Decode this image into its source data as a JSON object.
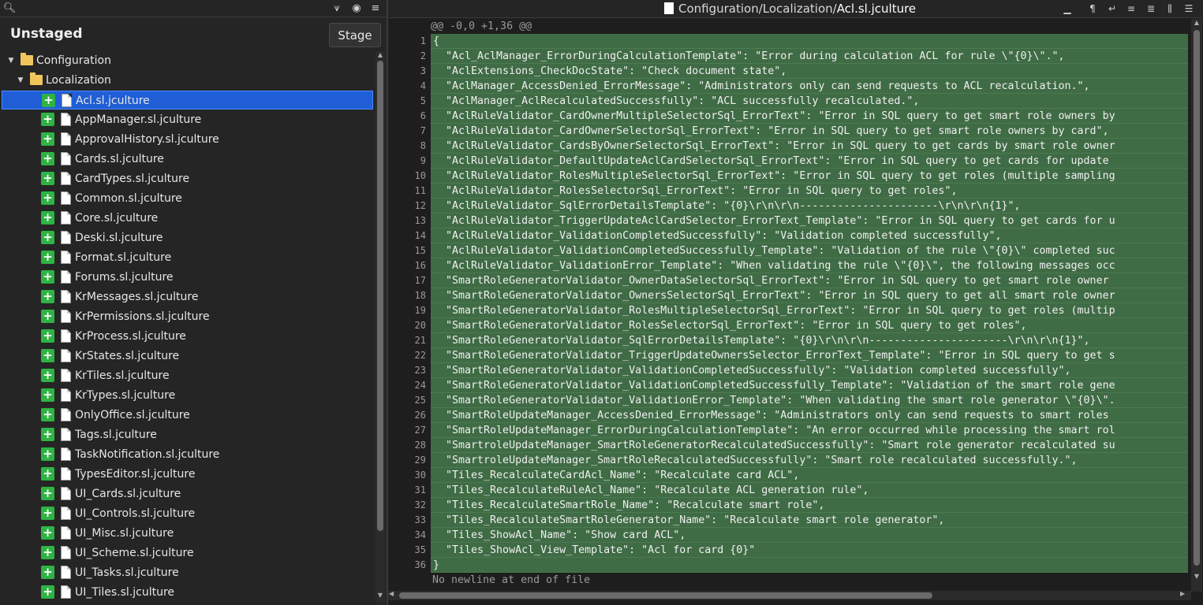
{
  "left_toolbar": {
    "search_placeholder": ""
  },
  "left_header": {
    "title": "Unstaged",
    "stage_label": "Stage"
  },
  "tree": {
    "folders": [
      {
        "label": "Configuration",
        "expanded": true
      },
      {
        "label": "Localization",
        "expanded": true
      }
    ],
    "selected_file": "Acl.sl.jculture",
    "files": [
      "Acl.sl.jculture",
      "AppManager.sl.jculture",
      "ApprovalHistory.sl.jculture",
      "Cards.sl.jculture",
      "CardTypes.sl.jculture",
      "Common.sl.jculture",
      "Core.sl.jculture",
      "Deski.sl.jculture",
      "Format.sl.jculture",
      "Forums.sl.jculture",
      "KrMessages.sl.jculture",
      "KrPermissions.sl.jculture",
      "KrProcess.sl.jculture",
      "KrStates.sl.jculture",
      "KrTiles.sl.jculture",
      "KrTypes.sl.jculture",
      "OnlyOffice.sl.jculture",
      "Tags.sl.jculture",
      "TaskNotification.sl.jculture",
      "TypesEditor.sl.jculture",
      "UI_Cards.sl.jculture",
      "UI_Controls.sl.jculture",
      "UI_Misc.sl.jculture",
      "UI_Scheme.sl.jculture",
      "UI_Tasks.sl.jculture",
      "UI_Tiles.sl.jculture"
    ]
  },
  "diff": {
    "path_prefix": "Configuration/Localization/",
    "file_name": "Acl.sl.jculture",
    "hunk_header": "@@ -0,0 +1,36 @@",
    "no_newline": "No newline at end of file",
    "lines": [
      "{",
      "  \"Acl_AclManager_ErrorDuringCalculationTemplate\": \"Error during calculation ACL for rule \\\"{0}\\\".\",",
      "  \"AclExtensions_CheckDocState\": \"Check document state\",",
      "  \"AclManager_AccessDenied_ErrorMessage\": \"Administrators only can send requests to ACL recalculation.\",",
      "  \"AclManager_AclRecalculatedSuccessfully\": \"ACL successfully recalculated.\",",
      "  \"AclRuleValidator_CardOwnerMultipleSelectorSql_ErrorText\": \"Error in SQL query to get smart role owners by",
      "  \"AclRuleValidator_CardOwnerSelectorSql_ErrorText\": \"Error in SQL query to get smart role owners by card\",",
      "  \"AclRuleValidator_CardsByOwnerSelectorSql_ErrorText\": \"Error in SQL query to get cards by smart role owner",
      "  \"AclRuleValidator_DefaultUpdateAclCardSelectorSql_ErrorText\": \"Error in SQL query to get cards for update",
      "  \"AclRuleValidator_RolesMultipleSelectorSql_ErrorText\": \"Error in SQL query to get roles (multiple sampling",
      "  \"AclRuleValidator_RolesSelectorSql_ErrorText\": \"Error in SQL query to get roles\",",
      "  \"AclRuleValidator_SqlErrorDetailsTemplate\": \"{0}\\r\\n\\r\\n----------------------\\r\\n\\r\\n{1}\",",
      "  \"AclRuleValidator_TriggerUpdateAclCardSelector_ErrorText_Template\": \"Error in SQL query to get cards for u",
      "  \"AclRuleValidator_ValidationCompletedSuccessfully\": \"Validation completed successfully\",",
      "  \"AclRuleValidator_ValidationCompletedSuccessfully_Template\": \"Validation of the rule \\\"{0}\\\" completed suc",
      "  \"AclRuleValidator_ValidationError_Template\": \"When validating the rule \\\"{0}\\\", the following messages occ",
      "  \"SmartRoleGeneratorValidator_OwnerDataSelectorSql_ErrorText\": \"Error in SQL query to get smart role owner",
      "  \"SmartRoleGeneratorValidator_OwnersSelectorSql_ErrorText\": \"Error in SQL query to get all smart role owner",
      "  \"SmartRoleGeneratorValidator_RolesMultipleSelectorSql_ErrorText\": \"Error in SQL query to get roles (multip",
      "  \"SmartRoleGeneratorValidator_RolesSelectorSql_ErrorText\": \"Error in SQL query to get roles\",",
      "  \"SmartRoleGeneratorValidator_SqlErrorDetailsTemplate\": \"{0}\\r\\n\\r\\n----------------------\\r\\n\\r\\n{1}\",",
      "  \"SmartRoleGeneratorValidator_TriggerUpdateOwnersSelector_ErrorText_Template\": \"Error in SQL query to get s",
      "  \"SmartRoleGeneratorValidator_ValidationCompletedSuccessfully\": \"Validation completed successfully\",",
      "  \"SmartRoleGeneratorValidator_ValidationCompletedSuccessfully_Template\": \"Validation of the smart role gene",
      "  \"SmartRoleGeneratorValidator_ValidationError_Template\": \"When validating the smart role generator \\\"{0}\\\".",
      "  \"SmartRoleUpdateManager_AccessDenied_ErrorMessage\": \"Administrators only can send requests to smart roles",
      "  \"SmartRoleUpdateManager_ErrorDuringCalculationTemplate\": \"An error occurred while processing the smart rol",
      "  \"SmartroleUpdateManager_SmartRoleGeneratorRecalculatedSuccessfully\": \"Smart role generator recalculated su",
      "  \"SmartroleUpdateManager_SmartRoleRecalculatedSuccessfully\": \"Smart role recalculated successfully.\",",
      "  \"Tiles_RecalculateCardAcl_Name\": \"Recalculate card ACL\",",
      "  \"Tiles_RecalculateRuleAcl_Name\": \"Recalculate ACL generation rule\",",
      "  \"Tiles_RecalculateSmartRole_Name\": \"Recalculate smart role\",",
      "  \"Tiles_RecalculateSmartRoleGenerator_Name\": \"Recalculate smart role generator\",",
      "  \"Tiles_ShowAcl_Name\": \"Show card ACL\",",
      "  \"Tiles_ShowAcl_View_Template\": \"Acl for card {0}\"",
      "}"
    ]
  },
  "icons": {
    "left_toolbar": [
      "search-icon",
      "collapse-all-icon",
      "eye-icon",
      "menu-icon"
    ],
    "right_toolbar": [
      "minimize-icon",
      "pilcrow-icon",
      "wrap-icon",
      "decrease-context-icon",
      "increase-context-icon",
      "diff-mode-icon",
      "more-icon"
    ]
  },
  "colors": {
    "added_bg": "#3f6b45",
    "selection": "#1f5ed6",
    "folder": "#f2c55c",
    "plus": "#2fb344"
  }
}
